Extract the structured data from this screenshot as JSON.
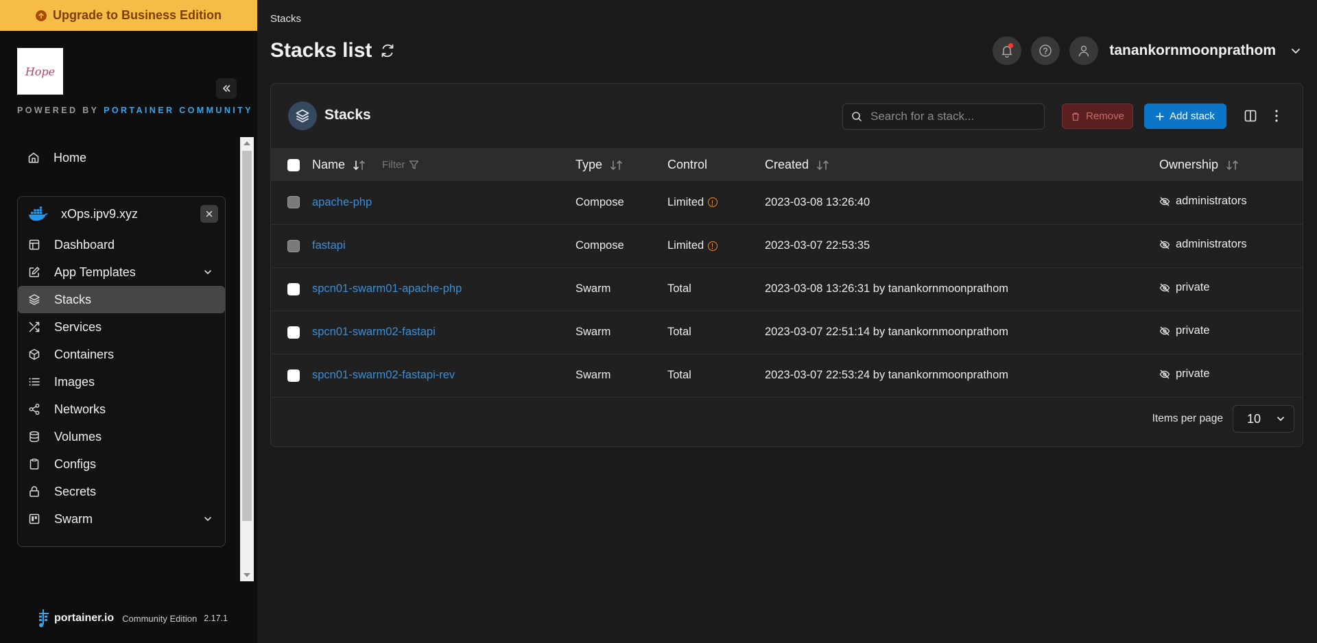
{
  "sidebar": {
    "upgrade_label": "Upgrade to Business Edition",
    "logo_text": "Hope",
    "powered_by": "POWERED BY",
    "powered_brand": "PORTAINER COMMUNITY",
    "home_label": "Home",
    "environment": {
      "name": "xOps.ipv9.xyz",
      "items": [
        {
          "label": "Dashboard",
          "icon": "dashboard-icon"
        },
        {
          "label": "App Templates",
          "icon": "edit-icon",
          "expandable": true
        },
        {
          "label": "Stacks",
          "icon": "layers-icon",
          "active": true
        },
        {
          "label": "Services",
          "icon": "shuffle-icon"
        },
        {
          "label": "Containers",
          "icon": "box-icon"
        },
        {
          "label": "Images",
          "icon": "list-icon"
        },
        {
          "label": "Networks",
          "icon": "share-icon"
        },
        {
          "label": "Volumes",
          "icon": "database-icon"
        },
        {
          "label": "Configs",
          "icon": "clipboard-icon"
        },
        {
          "label": "Secrets",
          "icon": "lock-icon"
        },
        {
          "label": "Swarm",
          "icon": "trello-icon",
          "expandable": true
        }
      ]
    },
    "footer": {
      "brand": "portainer.io",
      "edition": "Community Edition",
      "version": "2.17.1"
    }
  },
  "header": {
    "breadcrumb": "Stacks",
    "title": "Stacks list",
    "username": "tanankornmoonprathom"
  },
  "panel": {
    "title": "Stacks",
    "search_placeholder": "Search for a stack...",
    "remove_label": "Remove",
    "add_label": "Add stack",
    "columns": {
      "name": "Name",
      "filter": "Filter",
      "type": "Type",
      "control": "Control",
      "created": "Created",
      "ownership": "Ownership"
    },
    "rows": [
      {
        "name": "apache-php",
        "type": "Compose",
        "control": "Limited",
        "control_warning": true,
        "created": "2023-03-08 13:26:40",
        "ownership": "administrators",
        "selectable": false
      },
      {
        "name": "fastapi",
        "type": "Compose",
        "control": "Limited",
        "control_warning": true,
        "created": "2023-03-07 22:53:35",
        "ownership": "administrators",
        "selectable": false
      },
      {
        "name": "spcn01-swarm01-apache-php",
        "type": "Swarm",
        "control": "Total",
        "control_warning": false,
        "created": "2023-03-08 13:26:31 by tanankornmoonprathom",
        "ownership": "private",
        "selectable": true
      },
      {
        "name": "spcn01-swarm02-fastapi",
        "type": "Swarm",
        "control": "Total",
        "control_warning": false,
        "created": "2023-03-07 22:51:14 by tanankornmoonprathom",
        "ownership": "private",
        "selectable": true
      },
      {
        "name": "spcn01-swarm02-fastapi-rev",
        "type": "Swarm",
        "control": "Total",
        "control_warning": false,
        "created": "2023-03-07 22:53:24 by tanankornmoonprathom",
        "ownership": "private",
        "selectable": true
      }
    ],
    "pagination": {
      "label": "Items per page",
      "value": "10"
    }
  },
  "colors": {
    "upgrade_bg": "#f7bc45",
    "accent_blue": "#0b76c8",
    "link_blue": "#3a8fd6",
    "warning_orange": "#f08a24",
    "remove_red": "#5a1f1f"
  }
}
